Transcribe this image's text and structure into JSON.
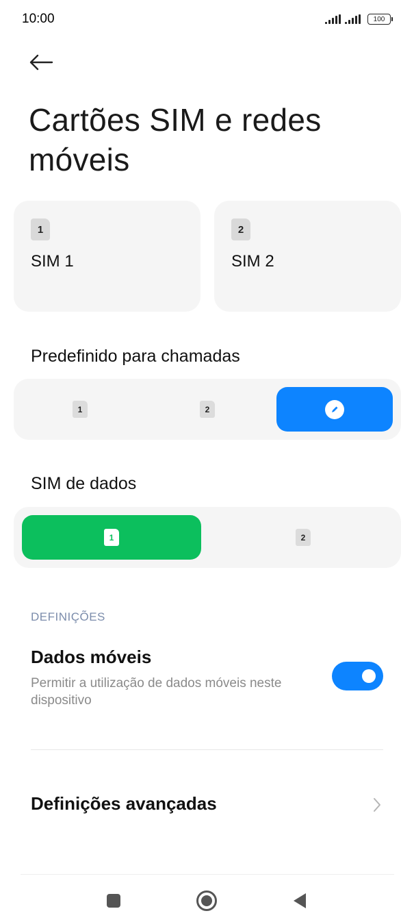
{
  "status_bar": {
    "time": "10:00",
    "battery": "100",
    "icons": [
      "signal-sim1-icon",
      "signal-sim2-icon",
      "battery-icon"
    ]
  },
  "header": {
    "back_icon": "arrow-left-icon",
    "title": "Cartões SIM e redes móveis"
  },
  "sim_cards": [
    {
      "badge": "1",
      "name": "SIM 1"
    },
    {
      "badge": "2",
      "name": "SIM 2"
    }
  ],
  "calls_default": {
    "label": "Predefinido para chamadas",
    "options": [
      {
        "badge": "1"
      },
      {
        "badge": "2"
      },
      {
        "icon": "edit-pencil-icon",
        "selected": true
      }
    ],
    "selected_color": "#0d84ff"
  },
  "data_sim": {
    "label": "SIM de dados",
    "options": [
      {
        "badge": "1",
        "selected": true
      },
      {
        "badge": "2"
      }
    ],
    "selected_color": "#0cbf5d"
  },
  "settings": {
    "section_header": "DEFINIÇÕES",
    "mobile_data": {
      "title": "Dados móveis",
      "description": "Permitir a utilização de dados móveis neste dispositivo",
      "enabled": true
    },
    "advanced": {
      "label": "Definições avançadas",
      "icon": "chevron-right-icon"
    }
  },
  "nav_bar": {
    "icons": [
      "recents-square-icon",
      "home-circle-icon",
      "back-triangle-icon"
    ]
  }
}
